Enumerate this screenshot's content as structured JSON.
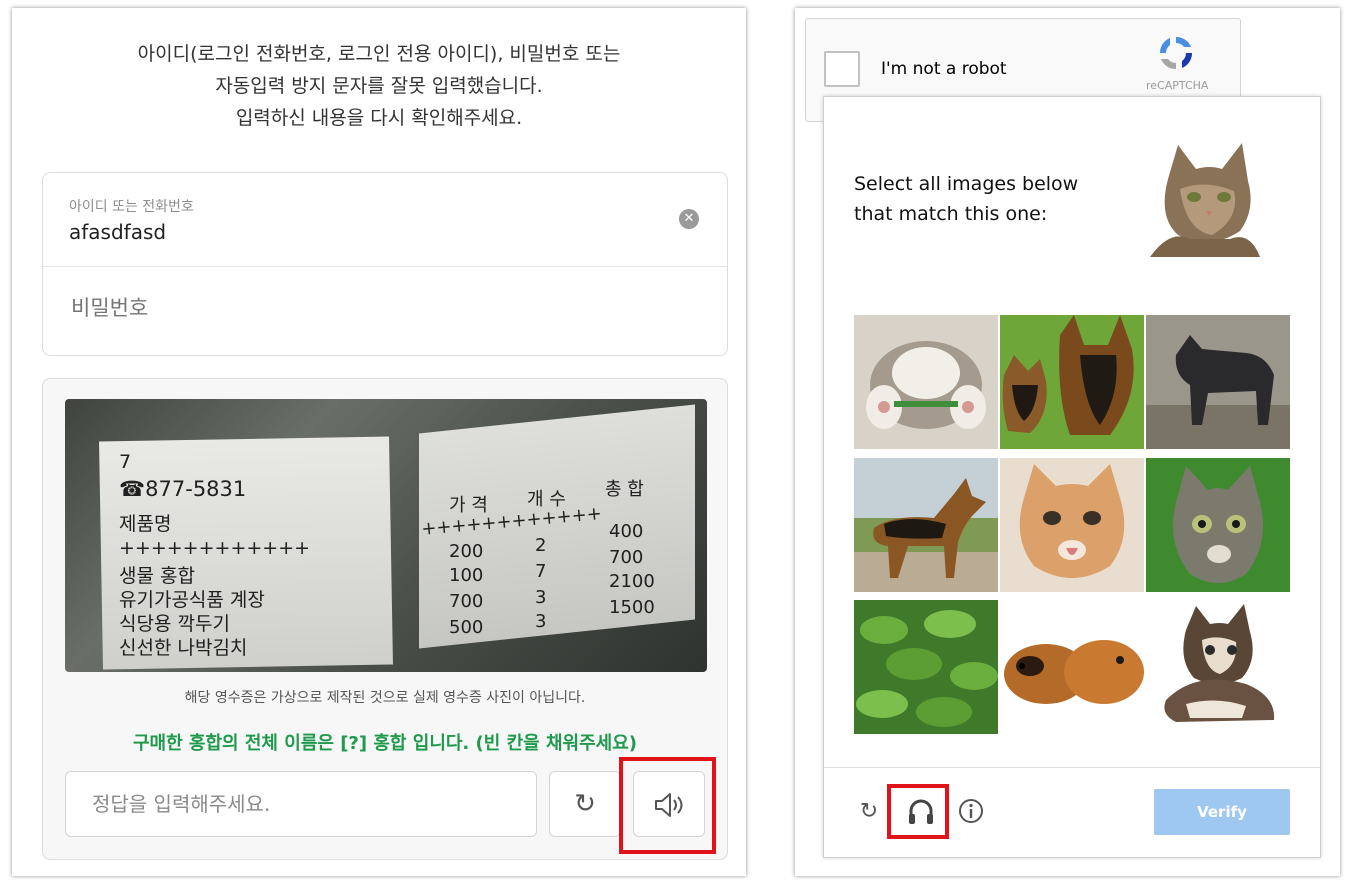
{
  "naver_login": {
    "error_lines": [
      "아이디(로그인 전화번호, 로그인 전용 아이디), 비밀번호 또는",
      "자동입력 방지 문자를 잘못 입력했습니다.",
      "입력하신 내용을 다시 확인해주세요."
    ],
    "id_label": "아이디 또는 전화번호",
    "id_value": "afasdfasd",
    "password_placeholder": "비밀번호",
    "receipt": {
      "left_lines": [
        "7",
        "☎877-5831",
        "제품명",
        "++++++++++++",
        "생물 홍합",
        "유기가공식품 계장",
        "식당용 깍두기",
        "신선한 나박김치"
      ],
      "headers": [
        "가 격",
        "개 수",
        "총 합"
      ],
      "plus_row": "++++++++++++",
      "prices": [
        "200",
        "100",
        "700",
        "500"
      ],
      "counts": [
        "2",
        "7",
        "3",
        "3"
      ],
      "totals": [
        "400",
        "700",
        "2100",
        "1500"
      ]
    },
    "disclaimer": "해당 영수증은 가상으로 제작된 것으로 실제 영수증 사진이 아닙니다.",
    "question": "구매한 홍합의 전체 이름은 [?] 홍합 입니다. (빈 칸을 채워주세요)",
    "answer_placeholder": "정답을 입력해주세요.",
    "refresh_icon": "↻",
    "audio_icon": "speaker-icon"
  },
  "recaptcha": {
    "checkbox_label": "I'm not a robot",
    "brand_text": "reCAPTCHA",
    "prompt_line1": "Select all images below",
    "prompt_line2": "that match this one:",
    "tiles": [
      "cat-paws-icon",
      "dog-with-puppy-icon",
      "black-dog-icon",
      "german-shepherd-icon",
      "orange-kitten-icon",
      "tabby-kitten-icon",
      "green-plant-icon",
      "guinea-pigs-icon",
      "small-kitten-icon"
    ],
    "verify_label": "Verify",
    "colors": {
      "verify_bg": "#9fc8f0",
      "highlight": "#e0131a",
      "question_green": "#1f9a4d"
    }
  }
}
